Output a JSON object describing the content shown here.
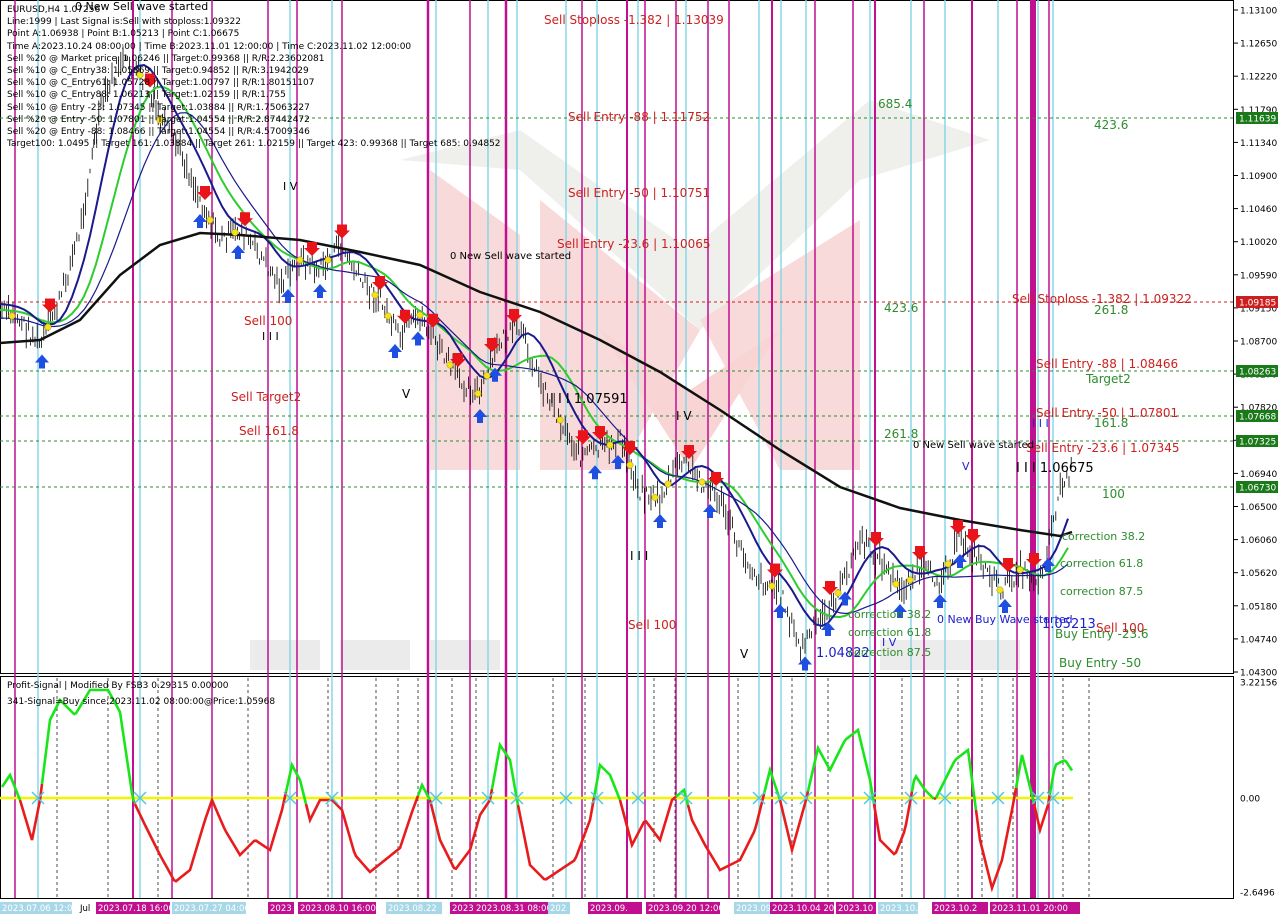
{
  "window": {
    "symbol": "EURUSD,H4"
  },
  "info_lines": [
    "EURUSD,H4  1.07256",
    "Line:1999 | Last Signal is:Sell with stoploss:1.09322",
    "Point A:1.06938 | Point B:1.05213 | Point C:1.06675",
    "Time A:2023.10.24 08:00:00 | Time B:2023.11.01 12:00:00 | Time C:2023.11.02 12:00:00",
    "Sell %20 @ Market price: 1.06246 || Target:0.99368 || R/R:2.23602081",
    "Sell %10 @ C_Entry38: 1.05869 || Target:0.94852 || R/R:3.1942029",
    "Sell %10 @ C_Entry61: 1.05728 || Target:1.00797 || R/R:1.80151107",
    "Sell %10 @ C_Entry88: 1.06213 || Target:1.02159 || R/R:1.755",
    "Sell %10 @ Entry -23: 1.07345 || Target:1.03884 || R/R:1.75063227",
    "Sell %20 @ Entry -50: 1.07801 || Target:1.04554 || R/R:2.87442472",
    "Sell %20 @ Entry -88: 1.08466 || Target:1.04554 || R/R:4.57009346",
    "Target100: 1.0495 || Target 161: 1.03884 || Target 261: 1.02159 || Target 423: 0.99368 || Target 685: 0.94852"
  ],
  "price_scale": [
    "1.13100",
    "1.12650",
    "1.12220",
    "1.11790",
    "1.11340",
    "1.10900",
    "1.10460",
    "1.10020",
    "1.09590",
    "1.09150",
    "1.08700",
    "1.08270",
    "1.07820",
    "1.07380",
    "1.06940",
    "1.06500",
    "1.06060",
    "1.05620",
    "1.05180",
    "1.04740",
    "1.04300"
  ],
  "price_tags": [
    {
      "text": "1.11639",
      "color": "#1a7a1a"
    },
    {
      "text": "1.09185",
      "color": "#cc1f1f"
    },
    {
      "text": "1.08263",
      "color": "#1a7a1a"
    },
    {
      "text": "1.07668",
      "color": "#1a7a1a"
    },
    {
      "text": "1.07325",
      "color": "#1a7a1a"
    },
    {
      "text": "1.06730",
      "color": "#1a7a1a"
    }
  ],
  "chart_labels": [
    {
      "text": "0 New Sell wave started",
      "color": "#000000"
    },
    {
      "text": "Sell Stoploss -1.382 | 1.13039",
      "color": "#cc1f1f"
    },
    {
      "text": "Sell Entry -88 | 1.11752",
      "color": "#cc1f1f"
    },
    {
      "text": "Sell Entry -50 | 1.10751",
      "color": "#cc1f1f"
    },
    {
      "text": "Sell Entry -23.6 | 1.10065",
      "color": "#cc1f1f"
    },
    {
      "text": "0 New Sell wave started",
      "color": "#000000"
    },
    {
      "text": "685.4",
      "color": "#2e8b2e"
    },
    {
      "text": "423.6",
      "color": "#2e8b2e"
    },
    {
      "text": "423.6",
      "color": "#2e8b2e"
    },
    {
      "text": "261.8",
      "color": "#2e8b2e"
    },
    {
      "text": "261.8",
      "color": "#2e8b2e"
    },
    {
      "text": "Sell 100",
      "color": "#cc1f1f"
    },
    {
      "text": "Sell Target2",
      "color": "#cc1f1f"
    },
    {
      "text": "Sell 161.8",
      "color": "#cc1f1f"
    },
    {
      "text": "I I I",
      "color": "#000000"
    },
    {
      "text": "V",
      "color": "#000000"
    },
    {
      "text": "I V",
      "color": "#000000"
    },
    {
      "text": "I I I  1.07591",
      "color": "#000000"
    },
    {
      "text": "I V",
      "color": "#000000"
    },
    {
      "text": "I I I",
      "color": "#000000"
    },
    {
      "text": "Sell 100",
      "color": "#cc1f1f"
    },
    {
      "text": "V",
      "color": "#000000"
    },
    {
      "text": "1.04822",
      "color": "#1c1cd0"
    },
    {
      "text": "Sell Stoploss -1.382 | 1.09322",
      "color": "#cc1f1f"
    },
    {
      "text": "Sell Entry -88 | 1.08466",
      "color": "#cc1f1f"
    },
    {
      "text": "Sell Entry -50 | 1.07801",
      "color": "#cc1f1f"
    },
    {
      "text": "Sell Entry -23.6 | 1.07345",
      "color": "#cc1f1f"
    },
    {
      "text": "Target2",
      "color": "#2e8b2e"
    },
    {
      "text": "161.8",
      "color": "#2e8b2e"
    },
    {
      "text": "100",
      "color": "#2e8b2e"
    },
    {
      "text": "0 New Sell wave started",
      "color": "#000000"
    },
    {
      "text": "V",
      "color": "#1c1cd0"
    },
    {
      "text": "I I I  1.06675",
      "color": "#000000"
    },
    {
      "text": "I I I",
      "color": "#1c1cd0"
    },
    {
      "text": "correction 38.2",
      "color": "#2e8b2e"
    },
    {
      "text": "correction 61.8",
      "color": "#2e8b2e"
    },
    {
      "text": "correction 87.5",
      "color": "#2e8b2e"
    },
    {
      "text": "correction 38.2",
      "color": "#2e8b2e"
    },
    {
      "text": "correction 61.8",
      "color": "#2e8b2e"
    },
    {
      "text": "correction 87.5",
      "color": "#2e8b2e"
    },
    {
      "text": "0 New Buy Wave started",
      "color": "#1c1cd0"
    },
    {
      "text": "1.05213",
      "color": "#1c1cd0"
    },
    {
      "text": "Buy Entry -23.6",
      "color": "#2e8b2e"
    },
    {
      "text": "Sell 100",
      "color": "#cc1f1f"
    },
    {
      "text": "Buy Entry -50",
      "color": "#2e8b2e"
    },
    {
      "text": "I V",
      "color": "#1c1cd0"
    }
  ],
  "indicator": {
    "title": "Profit-Signal | Modified By FSB3 0.29315 0.00000",
    "signal": "341-Signal=Buy since:2023.11.02 08:00:00@Price:1.05968",
    "scale": [
      "3.22156",
      "0.00",
      "-2.6496"
    ]
  },
  "time_labels": [
    "2023.07.06 12:00",
    "Jul",
    "2023.07.18 16:00",
    "2023.07.27 04:00",
    "2023",
    "2023.08.10 16:00",
    "2023.08.22",
    "2023",
    "2023.08.31 08:00",
    "202",
    "2023.09.",
    "2023.09.20 12:00",
    "2023.09",
    "2023.10.04 20",
    "2023.10",
    "2023.10.",
    "2023.10.2",
    "2023.11.01 20:00"
  ],
  "colors": {
    "sell_arrow": "#e8141a",
    "buy_arrow": "#1f4fe0",
    "ema_blue": "#1a1a8c",
    "ema_green": "#2ecc2e",
    "ma_black": "#111111",
    "magenta_line": "#c01090",
    "cyan_line": "#7fd6e6",
    "osc_up": "#19e619",
    "osc_down": "#e81c1c",
    "zero_line": "#f4f400"
  }
}
